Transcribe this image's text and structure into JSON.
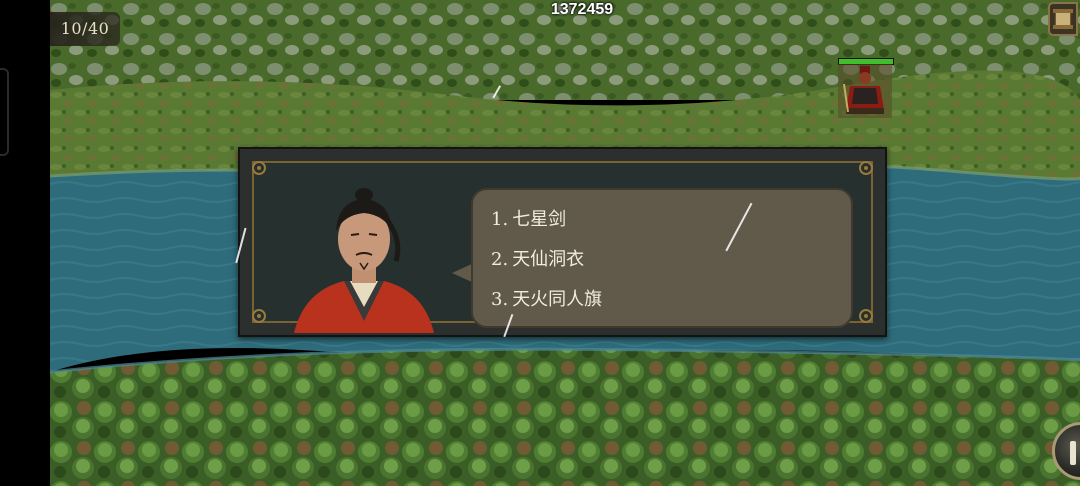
{
  "hud": {
    "turn_counter": "10/40",
    "gold": "1372459",
    "menu_icon": "scroll-menu-icon",
    "pause_icon": "pause-icon"
  },
  "unit": {
    "name_icon": "red-armored-general-icon",
    "hp_fraction": 1.0
  },
  "dialog": {
    "options": [
      {
        "num": "1.",
        "label": "七星剑"
      },
      {
        "num": "2.",
        "label": "天仙洞衣"
      },
      {
        "num": "3.",
        "label": "天火同人旗"
      }
    ]
  },
  "colors": {
    "river": "#2f6e7d",
    "grass": "#4d7a30",
    "forest": "#2f5a22",
    "dialog_bg": "#2b302e",
    "dialog_border": "#7a6332",
    "speech_bg": "#615a4a",
    "hp": "#3fbf2c"
  }
}
